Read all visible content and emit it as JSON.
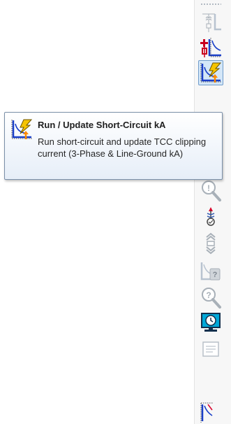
{
  "tooltip": {
    "title": "Run / Update Short-Circuit kA",
    "description": "Run short-circuit and update TCC clipping current (3-Phase & Line-Ground kA)",
    "icon": "short-circuit-tcc-icon"
  },
  "toolbar": {
    "buttons": [
      {
        "icon": "substation-oneline-icon",
        "enabled": false
      },
      {
        "icon": "add-protective-device-icon",
        "enabled": true
      },
      {
        "icon": "run-short-circuit-tcc-icon",
        "enabled": true,
        "active": true
      },
      {
        "icon": "zoom-search-icon",
        "enabled": false
      },
      {
        "icon": "relay-sensor-icon",
        "enabled": true
      },
      {
        "icon": "vertical-shift-icon",
        "enabled": false
      },
      {
        "icon": "tcc-check-icon",
        "enabled": false
      },
      {
        "icon": "help-query-icon",
        "enabled": false
      },
      {
        "icon": "monitor-clock-icon",
        "enabled": true
      },
      {
        "icon": "document-list-icon",
        "enabled": false
      },
      {
        "icon": "tcc-curve-icon",
        "enabled": true
      }
    ]
  },
  "colors": {
    "tooltip_border": "#7a8fa8",
    "active_button_bg": "#d4e7f8",
    "active_button_border": "#6f9ccb",
    "lightning": "#f5c400",
    "curve_blue": "#1a3fc8",
    "arrow_orange": "#ff8a00"
  }
}
